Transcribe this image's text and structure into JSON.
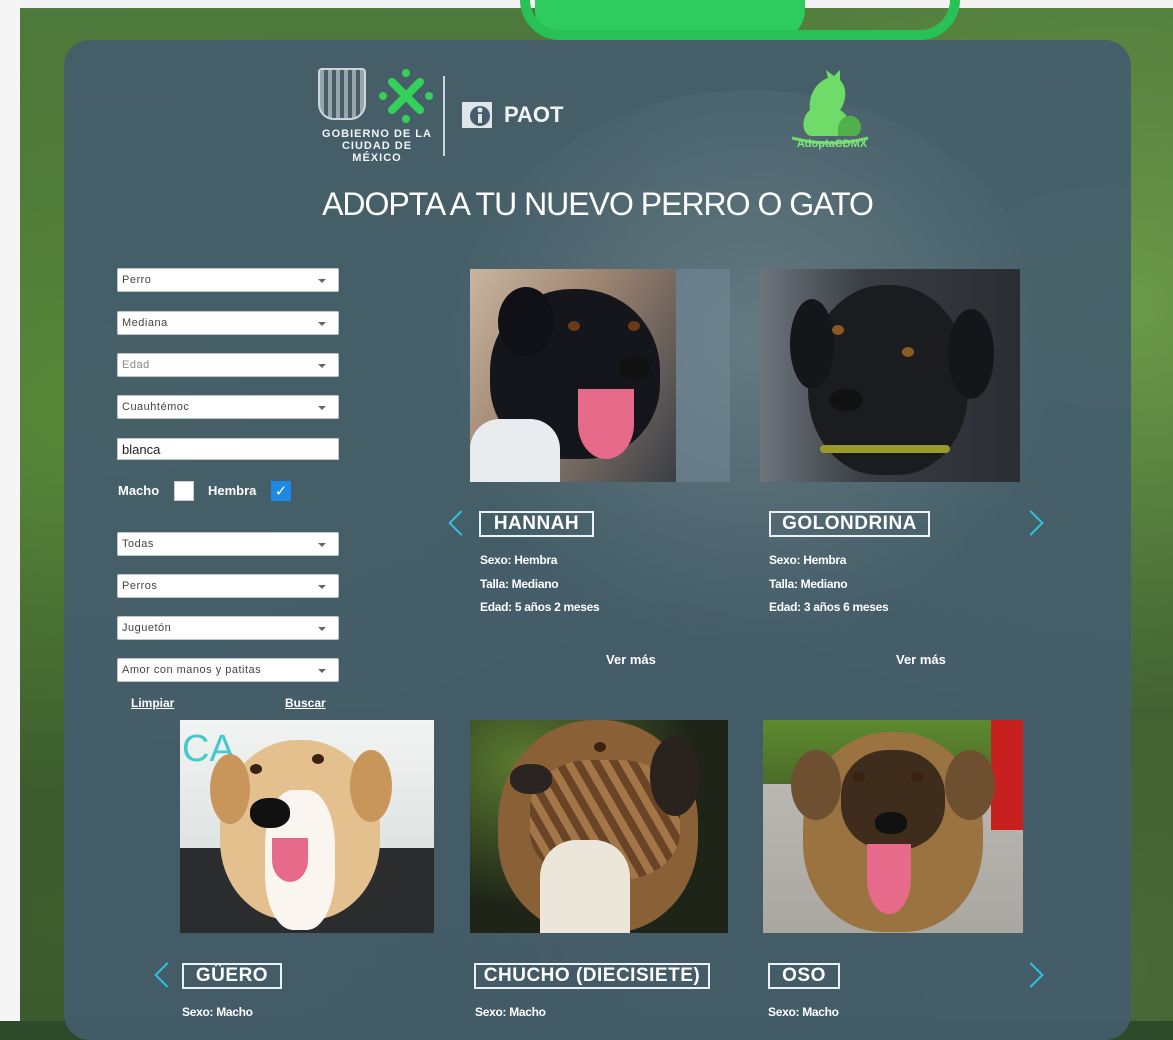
{
  "header": {
    "gob_line1": "GOBIERNO DE LA",
    "gob_line2": "CIUDAD DE MÉXICO",
    "paot": "PAOT",
    "adopta_brand": "AdoptaCDMX"
  },
  "page_title": "ADOPTA A TU NUEVO PERRO O GATO",
  "filters": {
    "especie": "Perro",
    "talla": "Mediana",
    "edad_placeholder": "Edad",
    "alcaldia": "Cuauhtémoc",
    "color_value": "blanca",
    "macho_label": "Macho",
    "macho_checked": false,
    "hembra_label": "Hembra",
    "hembra_checked": true,
    "convivencia": "Todas",
    "con_animales": "Perros",
    "caracter": "Juguetón",
    "personalidad": "Amor con manos y patitas",
    "limpiar": "Limpiar",
    "buscar": "Buscar"
  },
  "row1": [
    {
      "name": "HANNAH",
      "sexo": "Sexo: Hembra",
      "talla": "Talla: Mediano",
      "edad": "Edad: 5 años 2 meses",
      "ver_mas": "Ver más"
    },
    {
      "name": "GOLONDRINA",
      "sexo": "Sexo: Hembra",
      "talla": "Talla: Mediano",
      "edad": "Edad: 3 años 6 meses",
      "ver_mas": "Ver más"
    }
  ],
  "row2": [
    {
      "name": "GÜERO",
      "sexo": "Sexo: Macho"
    },
    {
      "name": "CHUCHO (DIECISIETE)",
      "sexo": "Sexo: Macho"
    },
    {
      "name": "OSO",
      "sexo": "Sexo: Macho"
    }
  ],
  "colors": {
    "panel": "#445c6c",
    "accent_arrow": "#2fc3de",
    "brand_green": "#2ecc5e",
    "checkbox_blue": "#1e88e5"
  }
}
